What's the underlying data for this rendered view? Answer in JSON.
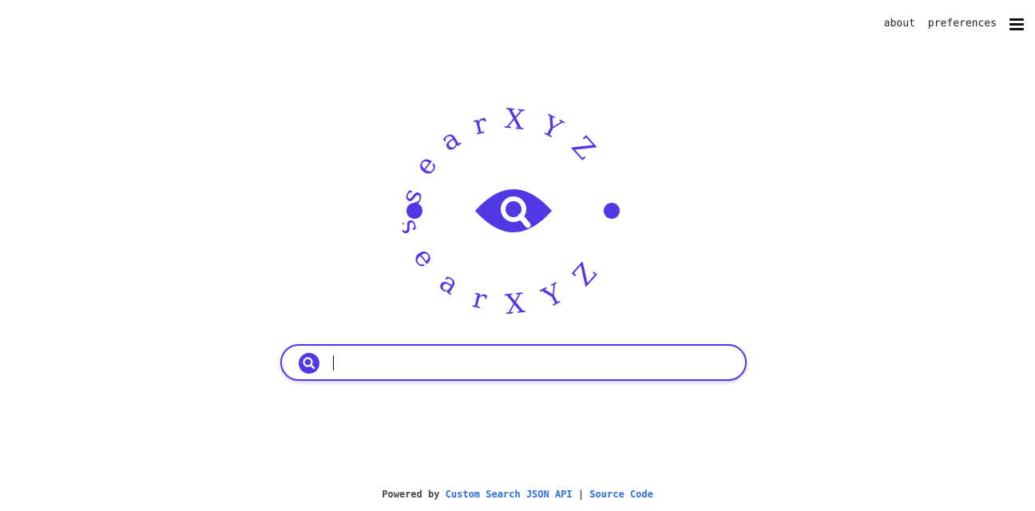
{
  "header": {
    "nav": [
      {
        "label": "about"
      },
      {
        "label": "preferences"
      }
    ],
    "menu_icon": "hamburger-menu-icon"
  },
  "logo": {
    "ring_text": "searXYZ",
    "center_icon": "eye-search-icon",
    "color": "#5039e5"
  },
  "search": {
    "value": "",
    "button_icon": "magnifier-icon",
    "accent": "#5039e5"
  },
  "footer": {
    "prefix": "Powered by",
    "link1": "Custom Search JSON API",
    "separator": "|",
    "link2": "Source Code",
    "link_color": "#2f6fe0"
  }
}
